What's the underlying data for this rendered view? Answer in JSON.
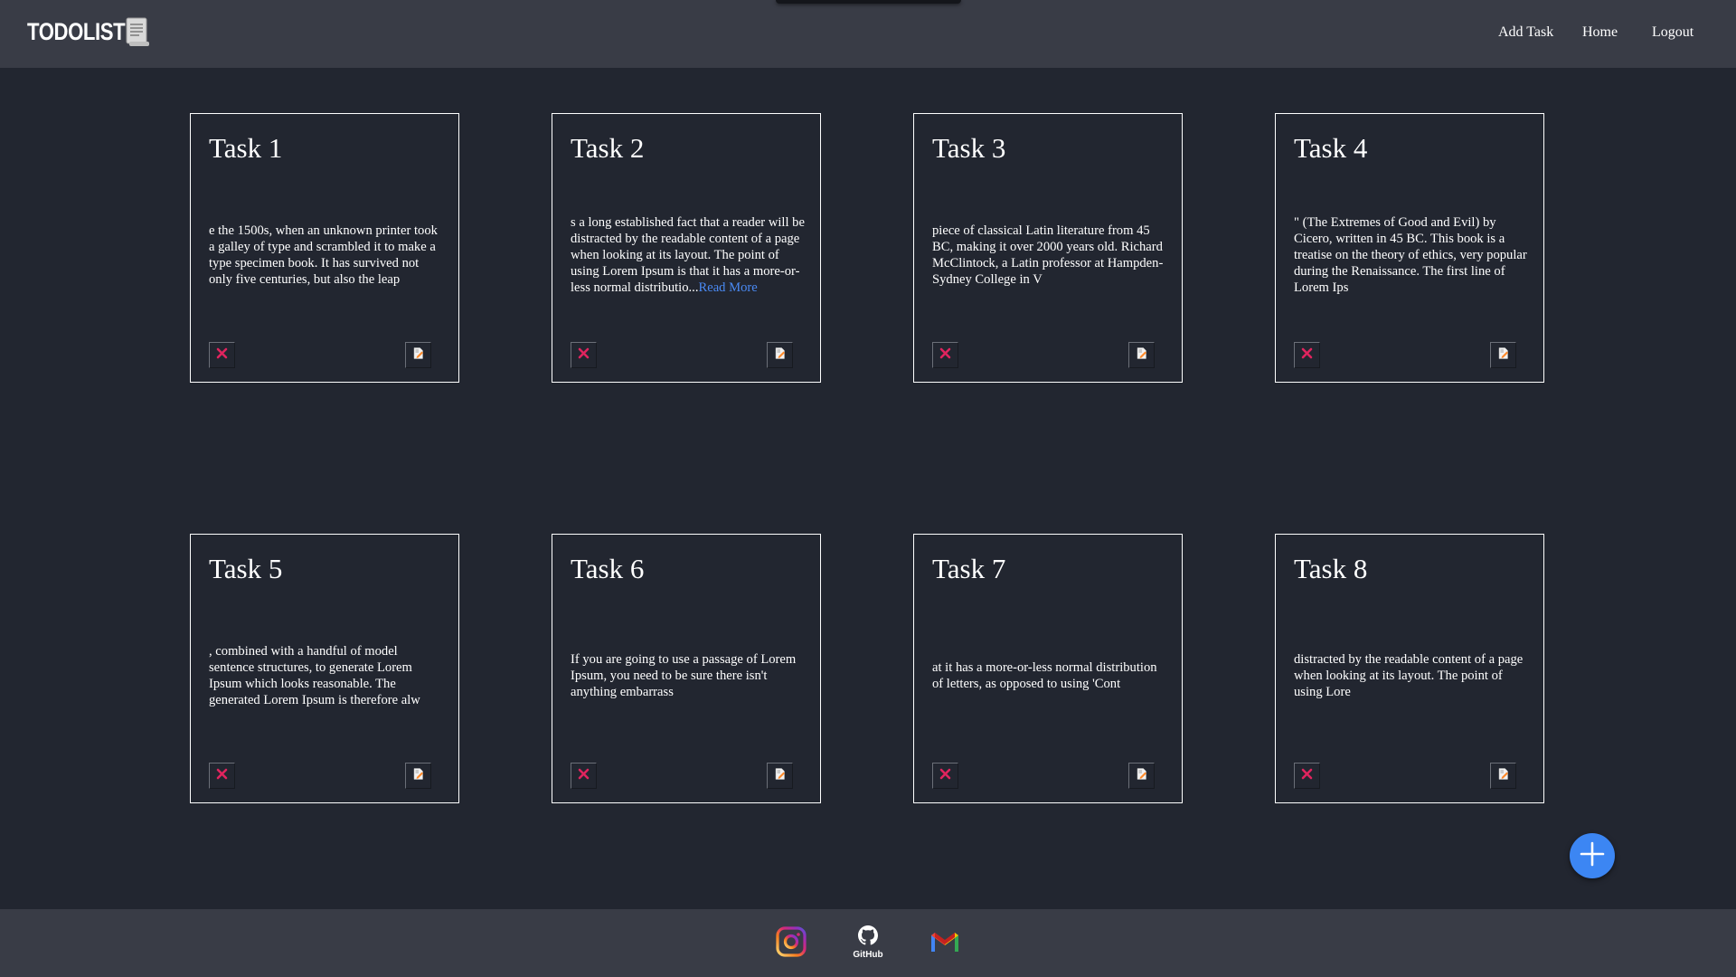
{
  "navbar": {
    "brand": "TODOLIST",
    "links": [
      "Add Task",
      "Home",
      "Logout"
    ]
  },
  "tasks": [
    {
      "title": "Task 1",
      "text": "e the 1500s, when an unknown printer took a galley of type and scrambled it to make a type specimen book. It has survived not only five centuries, but also the leap",
      "read_more": ""
    },
    {
      "title": "Task 2",
      "text": "s a long established fact that a reader will be distracted by the readable content of a page when looking at its layout. The point of using Lorem Ipsum is that it has a more-or-less normal distributio...",
      "read_more": "Read More"
    },
    {
      "title": "Task 3",
      "text": "piece of classical Latin literature from 45 BC, making it over 2000 years old. Richard McClintock, a Latin professor at Hampden-Sydney College in V",
      "read_more": ""
    },
    {
      "title": "Task 4",
      "text": "\" (The Extremes of Good and Evil) by Cicero, written in 45 BC. This book is a treatise on the theory of ethics, very popular during the Renaissance. The first line of Lorem Ips",
      "read_more": ""
    },
    {
      "title": "Task 5",
      "text": ", combined with a handful of model sentence structures, to generate Lorem Ipsum which looks reasonable. The generated Lorem Ipsum is therefore alw",
      "read_more": ""
    },
    {
      "title": "Task 6",
      "text": "If you are going to use a passage of Lorem Ipsum, you need to be sure there isn't anything embarrass",
      "read_more": ""
    },
    {
      "title": "Task 7",
      "text": "at it has a more-or-less normal distribution of letters, as opposed to using 'Cont",
      "read_more": ""
    },
    {
      "title": "Task 8",
      "text": "distracted by the readable content of a page when looking at its layout. The point of using Lore",
      "read_more": ""
    }
  ],
  "icons": {
    "brand": "notepad-icon",
    "delete": "close-icon",
    "edit": "edit-document-icon",
    "fab": "plus-icon",
    "footer": [
      "instagram-icon",
      "github-icon",
      "gmail-icon"
    ]
  },
  "footer": {
    "github_label": "GitHub"
  },
  "colors": {
    "background": "#222630",
    "bars": "#393c46",
    "delete": "#e0245e",
    "accent": "#3c86f3",
    "link": "#4a8af4"
  }
}
